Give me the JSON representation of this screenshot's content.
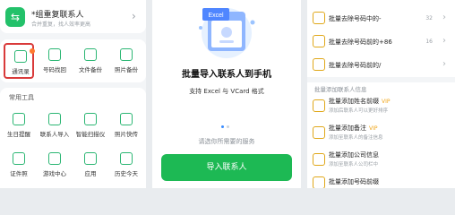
{
  "panel1": {
    "group_title": "*组重复联系人",
    "group_subtitle": "合并重复，找人效率更高",
    "top_tools": [
      {
        "label": "通讯录"
      },
      {
        "label": "号码找回"
      },
      {
        "label": "文件备份"
      },
      {
        "label": "照片备份"
      }
    ],
    "section_title": "常用工具",
    "tools_row1": [
      {
        "label": "生日提醒"
      },
      {
        "label": "联系人导入"
      },
      {
        "label": "智能扫描仪"
      },
      {
        "label": "照片快传"
      }
    ],
    "tools_row2": [
      {
        "label": "证件照"
      },
      {
        "label": "游戏中心"
      },
      {
        "label": "应用"
      },
      {
        "label": "历史今天"
      }
    ]
  },
  "panel2": {
    "illustration_label": "Excel",
    "title": "批量导入联系人到手机",
    "subtitle": "支持 Excel 与 VCard 格式",
    "hint": "请选你所需要的服务",
    "import_button": "导入联系人"
  },
  "panel3": {
    "rows": [
      {
        "title": "批量去除号码中的-",
        "badge": "32"
      },
      {
        "title": "批量去除号码前的+86",
        "badge": "16"
      },
      {
        "title": "批量去除号码前的/",
        "badge": ""
      }
    ],
    "category": "批量添加联系人信息",
    "add_rows": [
      {
        "title": "批量添加姓名前缀",
        "vip": "VIP",
        "sub": "添加后联系人可以更好排序"
      },
      {
        "title": "批量添加备注",
        "vip": "VIP",
        "sub": "添加至联系人的备注信息"
      },
      {
        "title": "批量添加公司信息",
        "vip": "",
        "sub": "添加至联系人公司栏中"
      },
      {
        "title": "批量添加号码前缀",
        "vip": "",
        "sub": ""
      }
    ]
  },
  "colors": {
    "accent": "#1db954",
    "selection": "#d93a3a",
    "notify_dot": "#ff7a2f",
    "vip": "#f0a51a"
  }
}
